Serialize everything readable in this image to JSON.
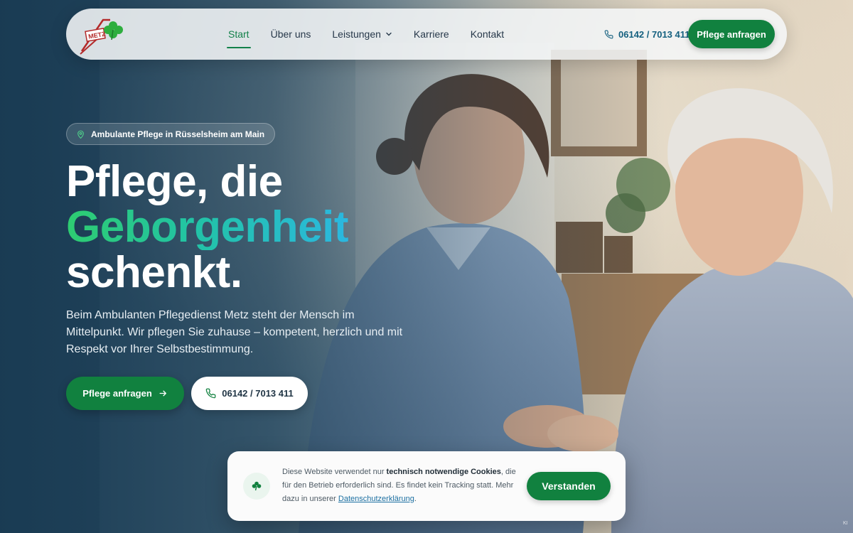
{
  "brand": {
    "logo_text": "METZ",
    "logo_icon": "clover-icon"
  },
  "nav": {
    "items": [
      {
        "label": "Start",
        "active": true
      },
      {
        "label": "Über uns"
      },
      {
        "label": "Leistungen",
        "has_dropdown": true
      },
      {
        "label": "Karriere"
      },
      {
        "label": "Kontakt"
      }
    ],
    "phone": "06142 / 7013 411",
    "cta": "Pflege anfragen"
  },
  "hero": {
    "badge": "Ambulante Pflege in Rüsselsheim am Main",
    "headline": {
      "line1": "Pflege, die",
      "highlight": "Geborgenheit",
      "line3": "schenkt."
    },
    "lead": "Beim Ambulanten Pflegedienst Metz steht der Mensch im Mittelpunkt. Wir pflegen Sie zuhause – kompetent, herzlich und mit Respekt vor Ihrer Selbstbestimmung.",
    "primary_button": "Pflege anfragen",
    "secondary_button": "06142 / 7013 411",
    "image_alt": "Pflegekraft lächelt ältere Frau an und hält ihre Hand"
  },
  "cookie": {
    "text_before": "Diese Website verwendet nur ",
    "text_bold": "technisch notwendige Cookies",
    "text_after": ", die für den Betrieb erforderlich sind. Es findet kein Tracking statt. Mehr dazu in unserer ",
    "link": "Datenschutzerklärung",
    "text_end": ".",
    "button": "Verstanden"
  },
  "corner_label": "KI",
  "colors": {
    "primary": "#11813f",
    "accent_blue": "#15607f",
    "gradient_start": "#2ecc71",
    "gradient_end": "#2bb8e0"
  }
}
